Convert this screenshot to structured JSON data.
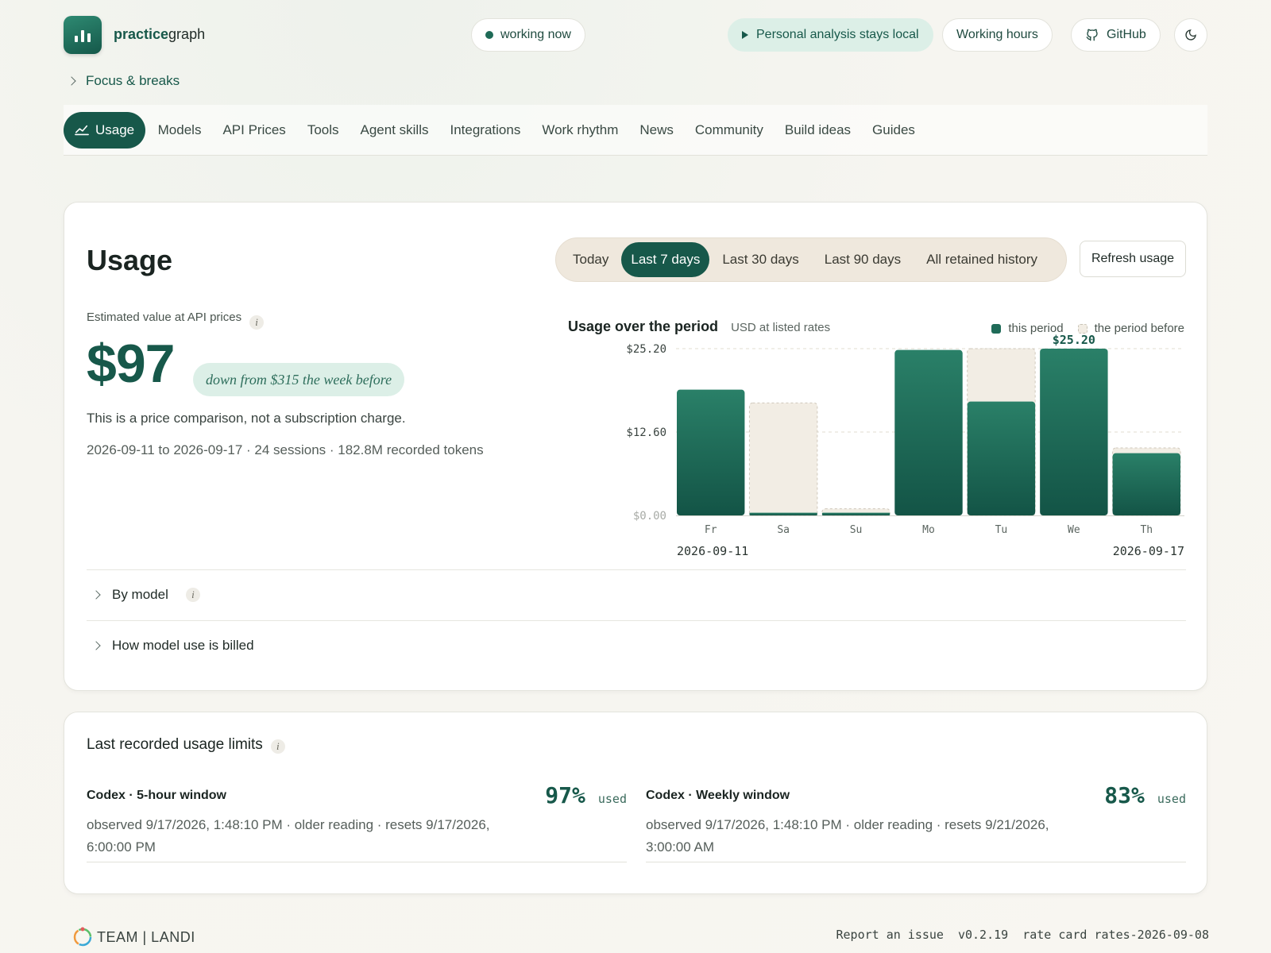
{
  "header": {
    "brand_bold": "practice",
    "brand_rest": "graph",
    "status": "working now",
    "local_pill": "Personal analysis stays local",
    "hours_pill": "Working hours",
    "github_pill": "GitHub"
  },
  "breadcrumb": {
    "label": "Focus & breaks"
  },
  "nav": {
    "items": [
      "Usage",
      "Models",
      "API Prices",
      "Tools",
      "Agent skills",
      "Integrations",
      "Work rhythm",
      "News",
      "Community",
      "Build ideas",
      "Guides"
    ],
    "active": "Usage"
  },
  "usage": {
    "title": "Usage",
    "periods": [
      "Today",
      "Last 7 days",
      "Last 30 days",
      "Last 90 days",
      "All retained history"
    ],
    "active_period": "Last 7 days",
    "refresh_label": "Refresh usage",
    "est_label": "Estimated value at API prices",
    "value": "$97",
    "down_note": "down from $315 the week before",
    "disclaimer": "This is a price comparison, not a subscription charge.",
    "range_line": "2026-09-11 to 2026-09-17 · 24 sessions · 182.8M recorded tokens",
    "by_model": "By model",
    "billing": "How model use is billed"
  },
  "chart_data": {
    "type": "bar",
    "title": "Usage over the period",
    "subtitle": "USD at listed rates",
    "categories": [
      "Fr",
      "Sa",
      "Su",
      "Mo",
      "Tu",
      "We",
      "Th"
    ],
    "series": [
      {
        "name": "this period",
        "values": [
          19.0,
          0.4,
          0.4,
          25.0,
          17.2,
          25.2,
          9.4
        ]
      },
      {
        "name": "the period before",
        "values": [
          0,
          17.0,
          1.0,
          0,
          25.2,
          0,
          10.2
        ]
      }
    ],
    "yticks": [
      "$0.00",
      "$12.60",
      "$25.20"
    ],
    "ylim": [
      0,
      25.2
    ],
    "peak_label": "$25.20",
    "start_label": "2026-09-11",
    "end_label": "2026-09-17",
    "colors": {
      "current": "#1f6b58",
      "previous": "#f2ede4"
    }
  },
  "limits": {
    "title": "Last recorded usage limits",
    "items": [
      {
        "name": "Codex · 5-hour window",
        "pct": "97%",
        "used": "used",
        "observed": "observed 9/17/2026, 1:48:10 PM · older reading · resets 9/17/2026, 6:00:00 PM"
      },
      {
        "name": "Codex · Weekly window",
        "pct": "83%",
        "used": "used",
        "observed": "observed 9/17/2026, 1:48:10 PM · older reading · resets 9/21/2026, 3:00:00 AM"
      }
    ]
  },
  "footer": {
    "logo_text": "TEAM | LANDI",
    "report": "Report an issue",
    "version": "v0.2.19",
    "rate_card": "rate card rates-2026-09-08"
  }
}
